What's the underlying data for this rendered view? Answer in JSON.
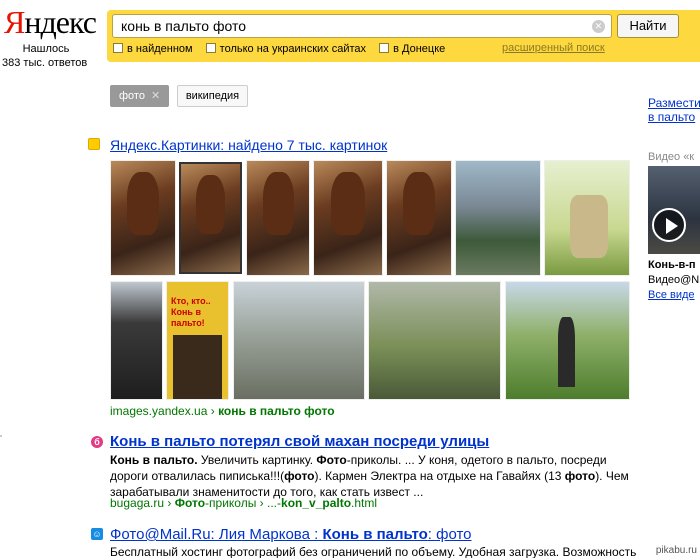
{
  "header": {
    "logo_first": "Я",
    "logo_rest": "ндекс",
    "found_label": "Нашлось",
    "found_count": "383 тыс. ответов"
  },
  "search": {
    "query": "конь в пальто фото",
    "clear_icon": "clear-x-icon",
    "button": "Найти",
    "options": [
      "в найденном",
      "только на украинских сайтах",
      "в Донецке"
    ],
    "advanced": "расширенный поиск"
  },
  "filters": {
    "active": "фото",
    "other": "википедия"
  },
  "sidebar": {
    "link_line1": "Размести",
    "link_line2": "в пальто",
    "video_header": "Видео «к",
    "video_title": "Конь-в-п",
    "video_source": "Видео@N",
    "video_all": "Все виде"
  },
  "results": [
    {
      "title": "Яндекс.Картинки: найдено 7 тыс. картинок",
      "url_domain": "images.yandex.ua",
      "url_sep": " › ",
      "url_path": "конь в пальто фото",
      "poster_text": "Кто, кто.. Конь в пальто!"
    },
    {
      "title": "Конь в пальто потерял свой махан посреди улицы",
      "snippet_bold1": "Конь в пальто.",
      "snippet_text1": " Увеличить картинку. ",
      "snippet_bold2": "Фото",
      "snippet_text2": "-приколы. ... У коня, одетого в пальто, посреди дороги отвалилась пиписька!!!(",
      "snippet_bold3": "фото",
      "snippet_text3": "). Кармен Электра на отдыхе на Гавайях (13 ",
      "snippet_bold4": "фото",
      "snippet_text4": "). Чем зарабатывали знаменитости до того, как стать извест ...",
      "url_domain": "bugaga.ru",
      "url_sep": " › ",
      "url_bold": "Фото",
      "url_rest": "-приколы › ...-",
      "url_bold2": "kon_v_palto",
      "url_end": ".html"
    },
    {
      "title_a": "Фото",
      "title_b": "@Mail.Ru: Лия Маркова : ",
      "title_c": "Конь в пальто",
      "title_d": ": ",
      "title_e": "фото",
      "snippet": "Бесплатный хостинг фотографий без ограничений по объему. Удобная загрузка. Возможность"
    }
  ],
  "watermark": "pikabu.ru"
}
